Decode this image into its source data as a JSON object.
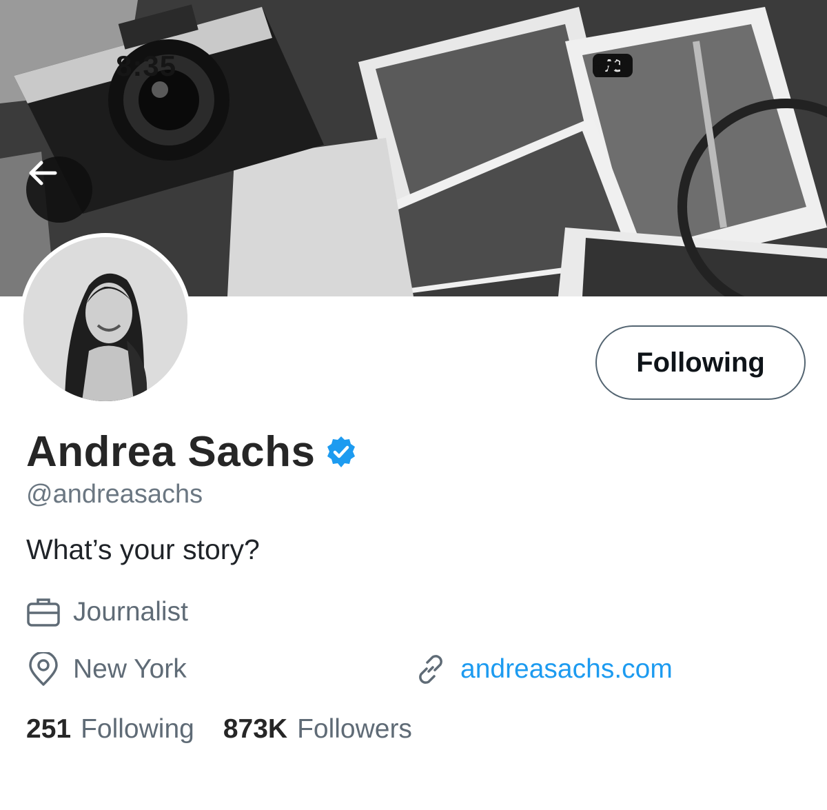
{
  "status_bar": {
    "time": "8:35",
    "battery": "73"
  },
  "profile": {
    "name": "Andrea Sachs",
    "handle": "@andreasachs",
    "bio": "What’s your story?",
    "occupation": "Journalist",
    "location": "New York",
    "website": "andreasachs.com",
    "following_count": "251",
    "following_label": "Following",
    "followers_count": "873K",
    "followers_label": "Followers",
    "verified": true
  },
  "actions": {
    "follow_button_label": "Following"
  },
  "icons": {
    "back": "arrow-left-icon",
    "verified": "verified-badge-icon",
    "occupation": "briefcase-icon",
    "location": "location-pin-icon",
    "website": "link-icon"
  },
  "colors": {
    "accent": "#1d9bf0",
    "secondary_text": "#536471",
    "primary_text": "#0f1419"
  }
}
